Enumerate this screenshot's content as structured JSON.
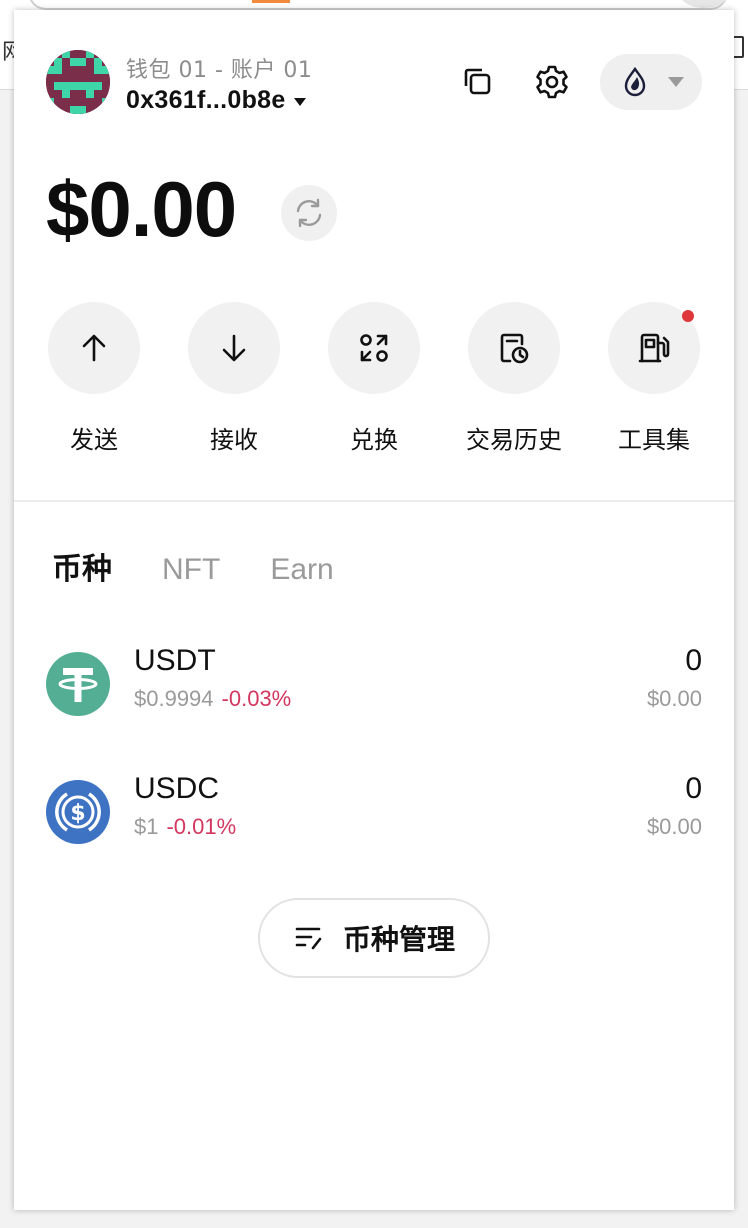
{
  "background": {
    "left_char": "网"
  },
  "header": {
    "wallet_name": "钱包 01 - 账户 01",
    "address": "0x361f...0b8e",
    "network_icon": "sui-droplet-icon"
  },
  "balance": {
    "amount": "$0.00"
  },
  "actions": [
    {
      "label": "发送",
      "icon": "arrow-up-icon"
    },
    {
      "label": "接收",
      "icon": "arrow-down-icon"
    },
    {
      "label": "兑换",
      "icon": "swap-icon"
    },
    {
      "label": "交易历史",
      "icon": "history-icon"
    },
    {
      "label": "工具集",
      "icon": "gas-station-icon",
      "has_notification": true
    }
  ],
  "tabs": [
    {
      "label": "币种",
      "active": true
    },
    {
      "label": "NFT",
      "active": false
    },
    {
      "label": "Earn",
      "active": false
    }
  ],
  "tokens": [
    {
      "symbol": "USDT",
      "price": "$0.9994",
      "change": "-0.03%",
      "amount": "0",
      "value": "$0.00",
      "color": "#53ae94"
    },
    {
      "symbol": "USDC",
      "price": "$1",
      "change": "-0.01%",
      "amount": "0",
      "value": "$0.00",
      "color": "#3e73c4"
    }
  ],
  "manage_button": {
    "label": "币种管理"
  },
  "colors": {
    "negative_change": "#d3375f",
    "notification_dot": "#e0373a",
    "secondary_text": "#9a9a9a"
  }
}
